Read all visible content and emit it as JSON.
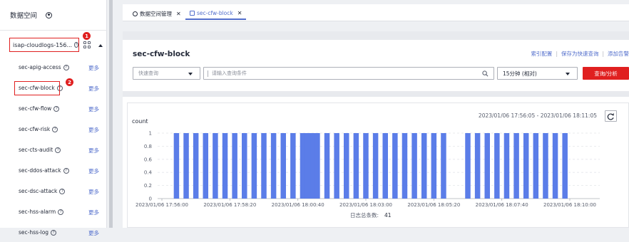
{
  "sidebar": {
    "title": "数据空间",
    "group_name": "isap-cloudlogs-156...",
    "badge_1": "1",
    "badge_2": "2",
    "streams": [
      {
        "name": "sec-apig-access",
        "more": "更多"
      },
      {
        "name": "sec-cfw-block",
        "more": "更多"
      },
      {
        "name": "sec-cfw-flow",
        "more": "更多"
      },
      {
        "name": "sec-cfw-risk",
        "more": "更多"
      },
      {
        "name": "sec-cts-audit",
        "more": "更多"
      },
      {
        "name": "sec-ddos-attack",
        "more": "更多"
      },
      {
        "name": "sec-dsc-attack",
        "more": "更多"
      },
      {
        "name": "sec-hss-alarm",
        "more": "更多"
      },
      {
        "name": "sec-hss-log",
        "more": "更多"
      }
    ]
  },
  "tabs": [
    {
      "label": "数据空间管理",
      "icon": "gear-icon"
    },
    {
      "label": "sec-cfw-block",
      "icon": "document-icon"
    }
  ],
  "query": {
    "stream_title": "sec-cfw-block",
    "actions": [
      "索引配置",
      "保存为快速查询",
      "添加告警"
    ],
    "quick_query_placeholder": "快速查询",
    "input_placeholder": "请输入查询条件",
    "time_range": "15分钟 (相对)",
    "button": "查询/分析"
  },
  "chart_data": {
    "type": "bar",
    "ylabel": "count",
    "time_range_text": "2023/01/06 17:56:05 - 2023/01/06 18:11:05",
    "yticks": [
      "0",
      "0.2",
      "0.4",
      "0.6",
      "0.8",
      "1"
    ],
    "ylim": [
      0,
      1
    ],
    "x_tick_labels": [
      "2023/01/06 17:56:00",
      "2023/01/06 17:58:20",
      "2023/01/06 18:00:40",
      "2023/01/06 18:03:00",
      "2023/01/06 18:05:20",
      "2023/01/06 18:07:40",
      "2023/01/06 18:10:00"
    ],
    "bar_groups": [
      {
        "start": "2023/01/06 17:56:30",
        "count": 15
      },
      {
        "start": "2023/01/06 18:01:00",
        "count": 15
      },
      {
        "start": "2023/01/06 18:06:30",
        "count": 11
      }
    ],
    "bar_value": 1,
    "bar_color": "#5b7de8",
    "total_label": "日志总条数:",
    "total_value": "41"
  }
}
